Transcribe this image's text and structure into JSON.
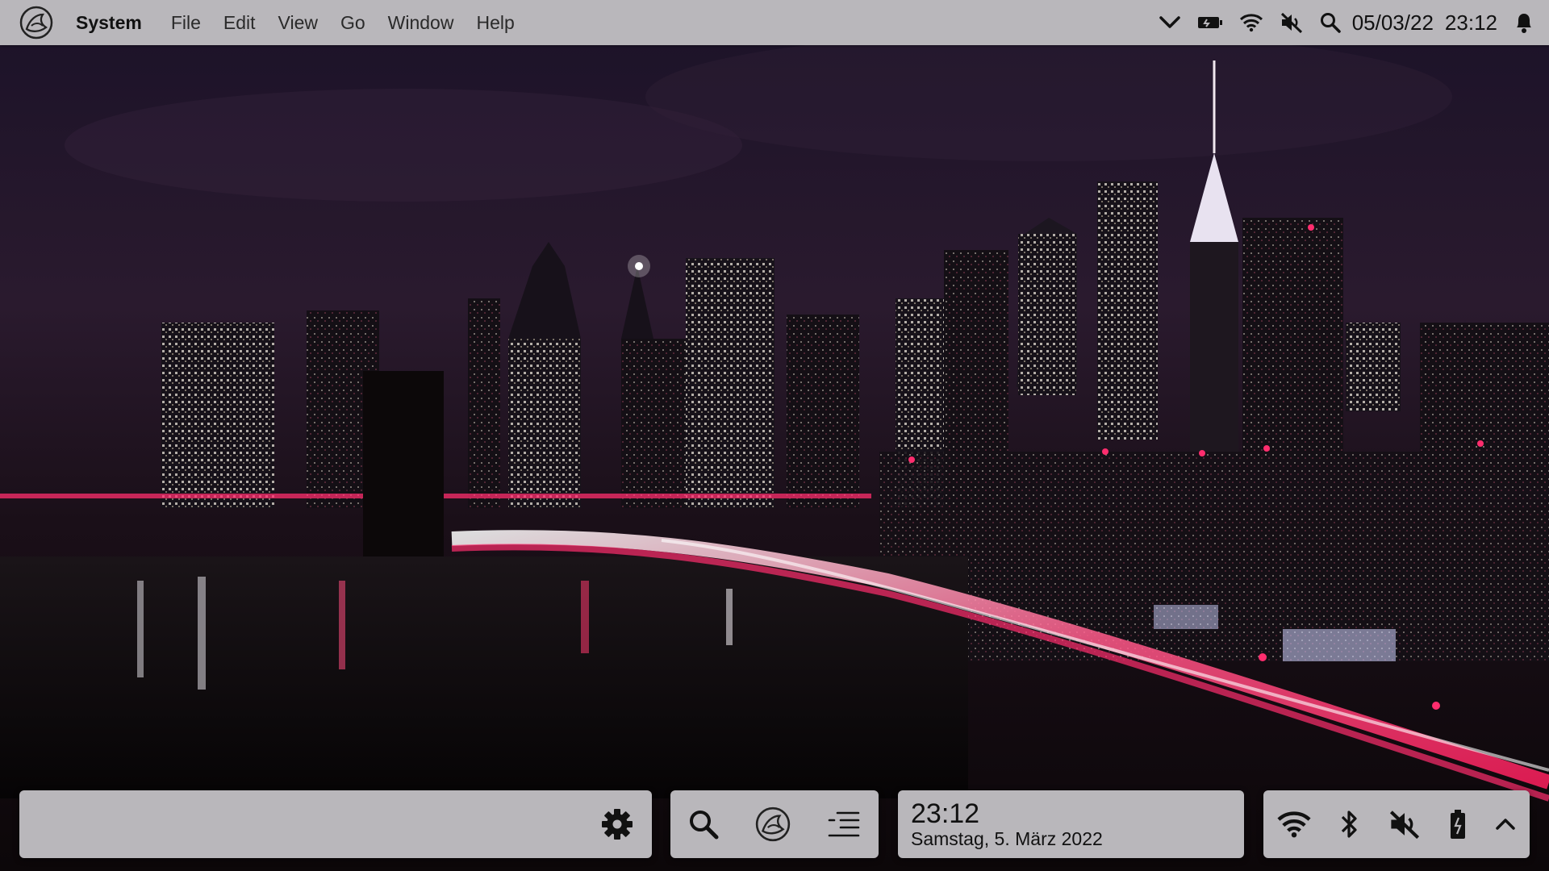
{
  "menubar": {
    "app_name": "System",
    "menus": [
      "File",
      "Edit",
      "View",
      "Go",
      "Window",
      "Help"
    ],
    "date": "05/03/22",
    "time": "23:12",
    "tray_icons": [
      "chevron-down-icon",
      "battery-icon",
      "wifi-icon",
      "volume-muted-icon",
      "search-icon",
      "bell-icon"
    ]
  },
  "dock": {
    "settings_icon": "gear-icon",
    "apps": [
      "search-icon",
      "launcher-logo-icon",
      "task-list-icon"
    ]
  },
  "clock_panel": {
    "time": "23:12",
    "date": "Samstag, 5. März 2022"
  },
  "status_panel": {
    "icons": [
      "wifi-icon",
      "bluetooth-icon",
      "volume-muted-icon",
      "battery-icon",
      "chevron-up-icon"
    ]
  },
  "colors": {
    "panel_bg": "#b9b7bb",
    "text": "#111111",
    "wallpaper_accent": "#ff2d6e"
  }
}
